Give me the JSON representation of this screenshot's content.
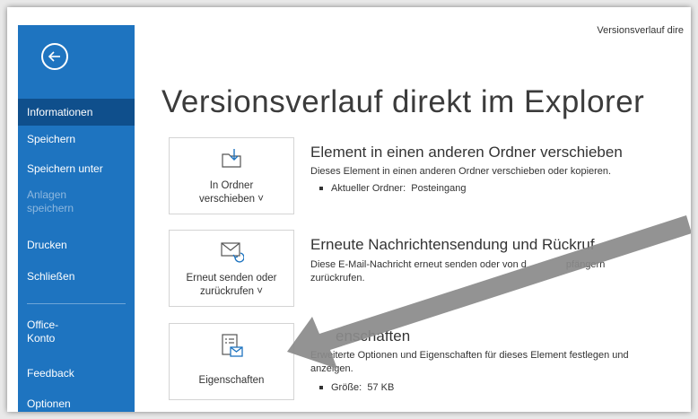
{
  "window": {
    "title": "Versionsverlauf dire"
  },
  "sidebar": {
    "back_icon": "arrow-left-icon",
    "items": [
      {
        "label": "Informationen"
      },
      {
        "label": "Speichern"
      },
      {
        "label": "Speichern unter"
      },
      {
        "label": "Anlagen speichern"
      },
      {
        "label": "Drucken"
      },
      {
        "label": "Schließen"
      },
      {
        "label": "Office-Konto"
      },
      {
        "label": "Feedback"
      },
      {
        "label": "Optionen"
      }
    ]
  },
  "main": {
    "title": "Versionsverlauf direkt im Explorer",
    "sections": [
      {
        "button_label_line1": "In Ordner",
        "button_label_line2": "verschieben ˅",
        "icon": "folder-move-icon",
        "heading": "Element in einen anderen Ordner verschieben",
        "description": "Dieses Element in einen anderen Ordner verschieben oder kopieren.",
        "detail_label": "Aktueller Ordner:",
        "detail_value": "Posteingang"
      },
      {
        "button_label_line1": "Erneut senden oder",
        "button_label_line2": "zurückrufen ˅",
        "icon": "mail-resend-icon",
        "heading": "Erneute Nachrichtensendung und Rückruf",
        "description_line1": "Diese E-Mail-Nachricht erneut senden oder von d",
        "description_line1_end": "pfängern",
        "description_line2": "zurückrufen."
      },
      {
        "button_label": "Eigenschaften",
        "icon": "properties-icon",
        "heading": "enschaften",
        "description_line1": "Erweiterte Optionen und Eigenschaften für dieses Element festlegen und",
        "description_line2": "anzeigen.",
        "detail_label": "Größe:",
        "detail_value": "57 KB"
      }
    ]
  },
  "colors": {
    "sidebar_bg": "#1e74c0",
    "sidebar_active": "#0f4f8c",
    "annotation_arrow": "#8a8a8a"
  }
}
